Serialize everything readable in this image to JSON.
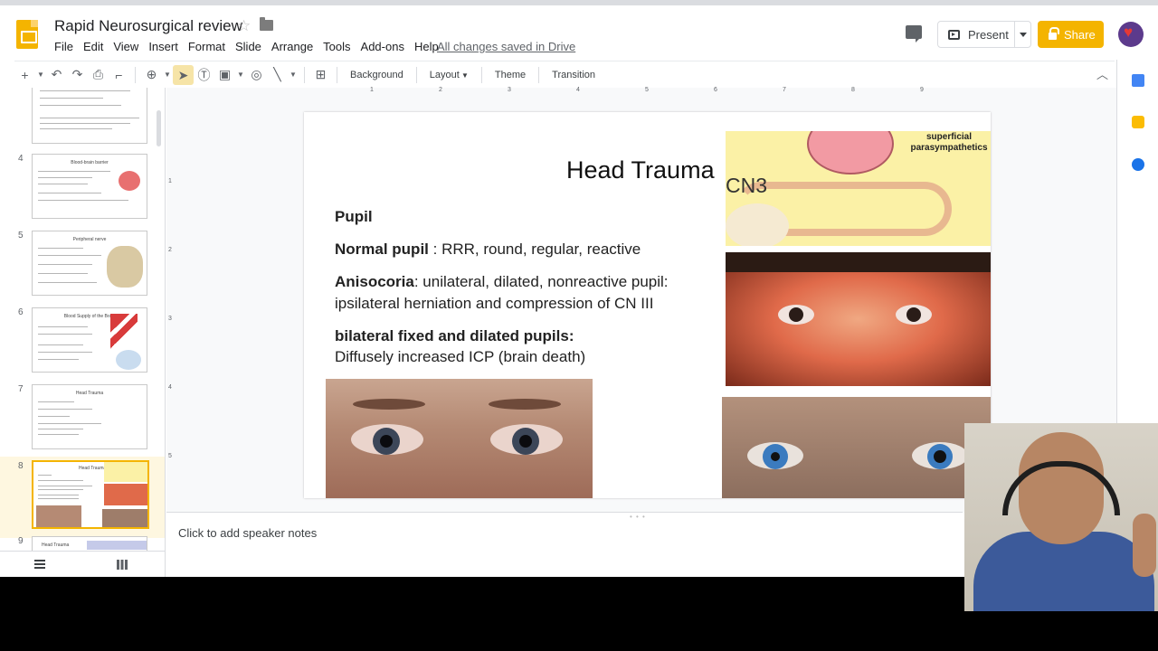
{
  "app": {
    "doc_title": "Rapid Neurosurgical review",
    "menu": [
      "File",
      "Edit",
      "View",
      "Insert",
      "Format",
      "Slide",
      "Arrange",
      "Tools",
      "Add-ons",
      "Help"
    ],
    "saved_status": "All changes saved in Drive",
    "present_label": "Present",
    "share_label": "Share",
    "accent_color": "#f4b400"
  },
  "toolbar": {
    "background_label": "Background",
    "layout_label": "Layout",
    "theme_label": "Theme",
    "transition_label": "Transition"
  },
  "ruler": {
    "top": [
      "1",
      "2",
      "3",
      "4",
      "5",
      "6",
      "7",
      "8",
      "9"
    ],
    "left": [
      "1",
      "2",
      "3",
      "4",
      "5"
    ]
  },
  "filmstrip": {
    "slides": [
      {
        "num": "",
        "title": ""
      },
      {
        "num": "4",
        "title": "Blood-brain barrier"
      },
      {
        "num": "5",
        "title": "Peripheral nerve"
      },
      {
        "num": "6",
        "title": "Blood Supply of the Brain"
      },
      {
        "num": "7",
        "title": "Head Trauma"
      },
      {
        "num": "8",
        "title": "Head Trauma"
      },
      {
        "num": "9",
        "title": "Head Trauma"
      }
    ],
    "active_index": 5
  },
  "slide": {
    "title": "Head Trauma",
    "subtitle": "Pupil",
    "normal_label": "Normal  pupil",
    "normal_text": " : RRR, round, regular, reactive",
    "aniso_label": "Anisocoria",
    "aniso_text": ": unilateral, dilated, nonreactive pupil:",
    "aniso_line2": "ipsilateral herniation and compression of CN III",
    "bilateral_label": "bilateral fixed and dilated pupils:",
    "bilateral_text": "Diffusely increased ICP (brain death)",
    "diagram_label": "superficial parasympathetics",
    "diagram_cn3": "CN3"
  },
  "notes": {
    "placeholder": "Click to add speaker notes"
  }
}
